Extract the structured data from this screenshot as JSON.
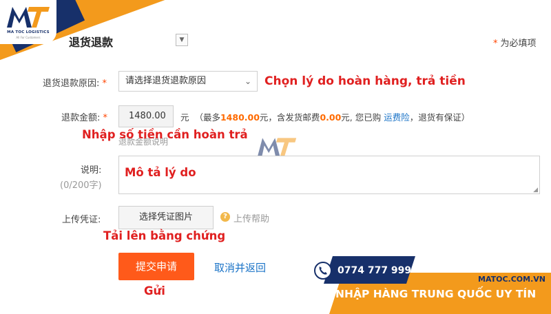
{
  "brand": {
    "logo_mark": "MT",
    "logo_name": "MA TOC LOGISTICS",
    "logo_tagline": "All For Customers",
    "website": "MATOC.COM.VN",
    "phone": "0774 777 999",
    "slogan": "NHẬP HÀNG TRUNG QUỐC UY TÍN",
    "colors": {
      "navy": "#17306a",
      "orange": "#f39a1c"
    }
  },
  "form": {
    "title": "退货退款",
    "required_note": "为必填项",
    "reason": {
      "label": "退货退款原因:",
      "selected": "请选择退货退款原因"
    },
    "amount": {
      "label": "退款金额:",
      "value": "1480.00",
      "unit": "元",
      "detail_prefix": "（最多",
      "max": "1480.00",
      "detail_mid": "元，含发货邮费",
      "shipping": "0.00",
      "detail_mid2": "元, 您已购",
      "insurance_link": "运费险",
      "detail_suffix": "，退货有保证）",
      "hint": "退款金额说明"
    },
    "description": {
      "label": "说明:",
      "counter": "(0/200字)"
    },
    "upload": {
      "label": "上传凭证:",
      "button": "选择凭证图片",
      "help_icon": "question-icon",
      "help": "上传帮助"
    },
    "submit": "提交申请",
    "cancel": "取消并返回"
  },
  "annotations": {
    "reason": "Chọn lý do hoàn hàng, trả tiền",
    "amount": "Nhập số tiền cần hoàn trả",
    "description": "Mô tả lý do",
    "upload": "Tải lên bằng chứng",
    "submit": "Gửi"
  }
}
